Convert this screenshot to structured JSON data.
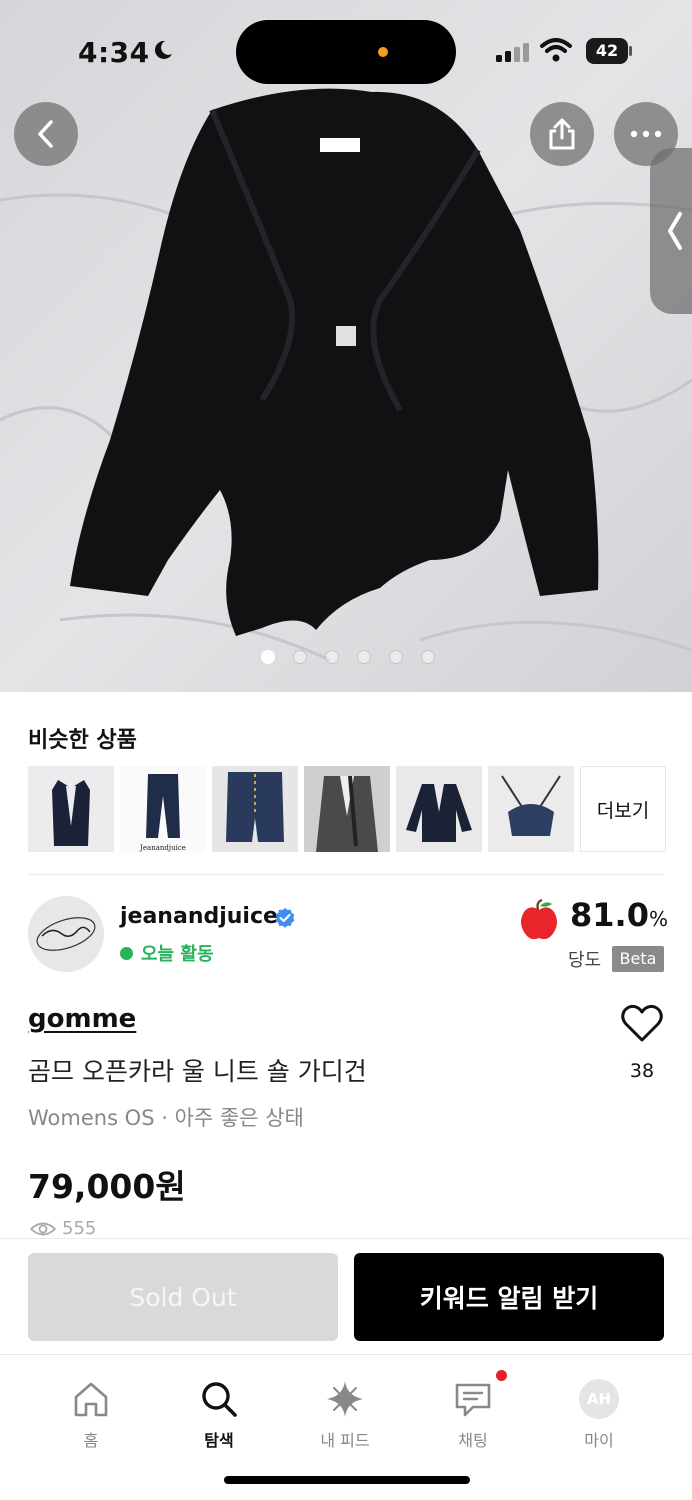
{
  "status_bar": {
    "time": "4:34",
    "battery": "42"
  },
  "hero": {
    "image_label": "gomme",
    "photo_count": 6,
    "active_index": 0
  },
  "similar": {
    "title": "비슷한 상품",
    "thumb_caption": "Jeanandjuice",
    "more_label": "더보기"
  },
  "seller": {
    "name": "jeanandjuice",
    "activity": "오늘 활동",
    "score": "81.0",
    "score_unit": "%",
    "score_label": "당도",
    "beta": "Beta"
  },
  "product": {
    "brand": "gomme",
    "title": "곰므 오픈카라 울 니트 숄 가디건",
    "meta": "Womens OS · 아주 좋은 상태",
    "price": "79,000원",
    "likes": "38",
    "views": "555"
  },
  "actions": {
    "sold_out": "Sold Out",
    "keyword_alert": "키워드 알림 받기"
  },
  "tabbar": {
    "home": "홈",
    "search": "탐색",
    "feed": "내 피드",
    "chat": "채팅",
    "my": "마이",
    "my_avatar": "AH"
  },
  "colors": {
    "accent_green": "#25b35c",
    "verified_blue": "#3d8ef0",
    "notification_red": "#e8202b",
    "apple_red": "#e8262a"
  }
}
